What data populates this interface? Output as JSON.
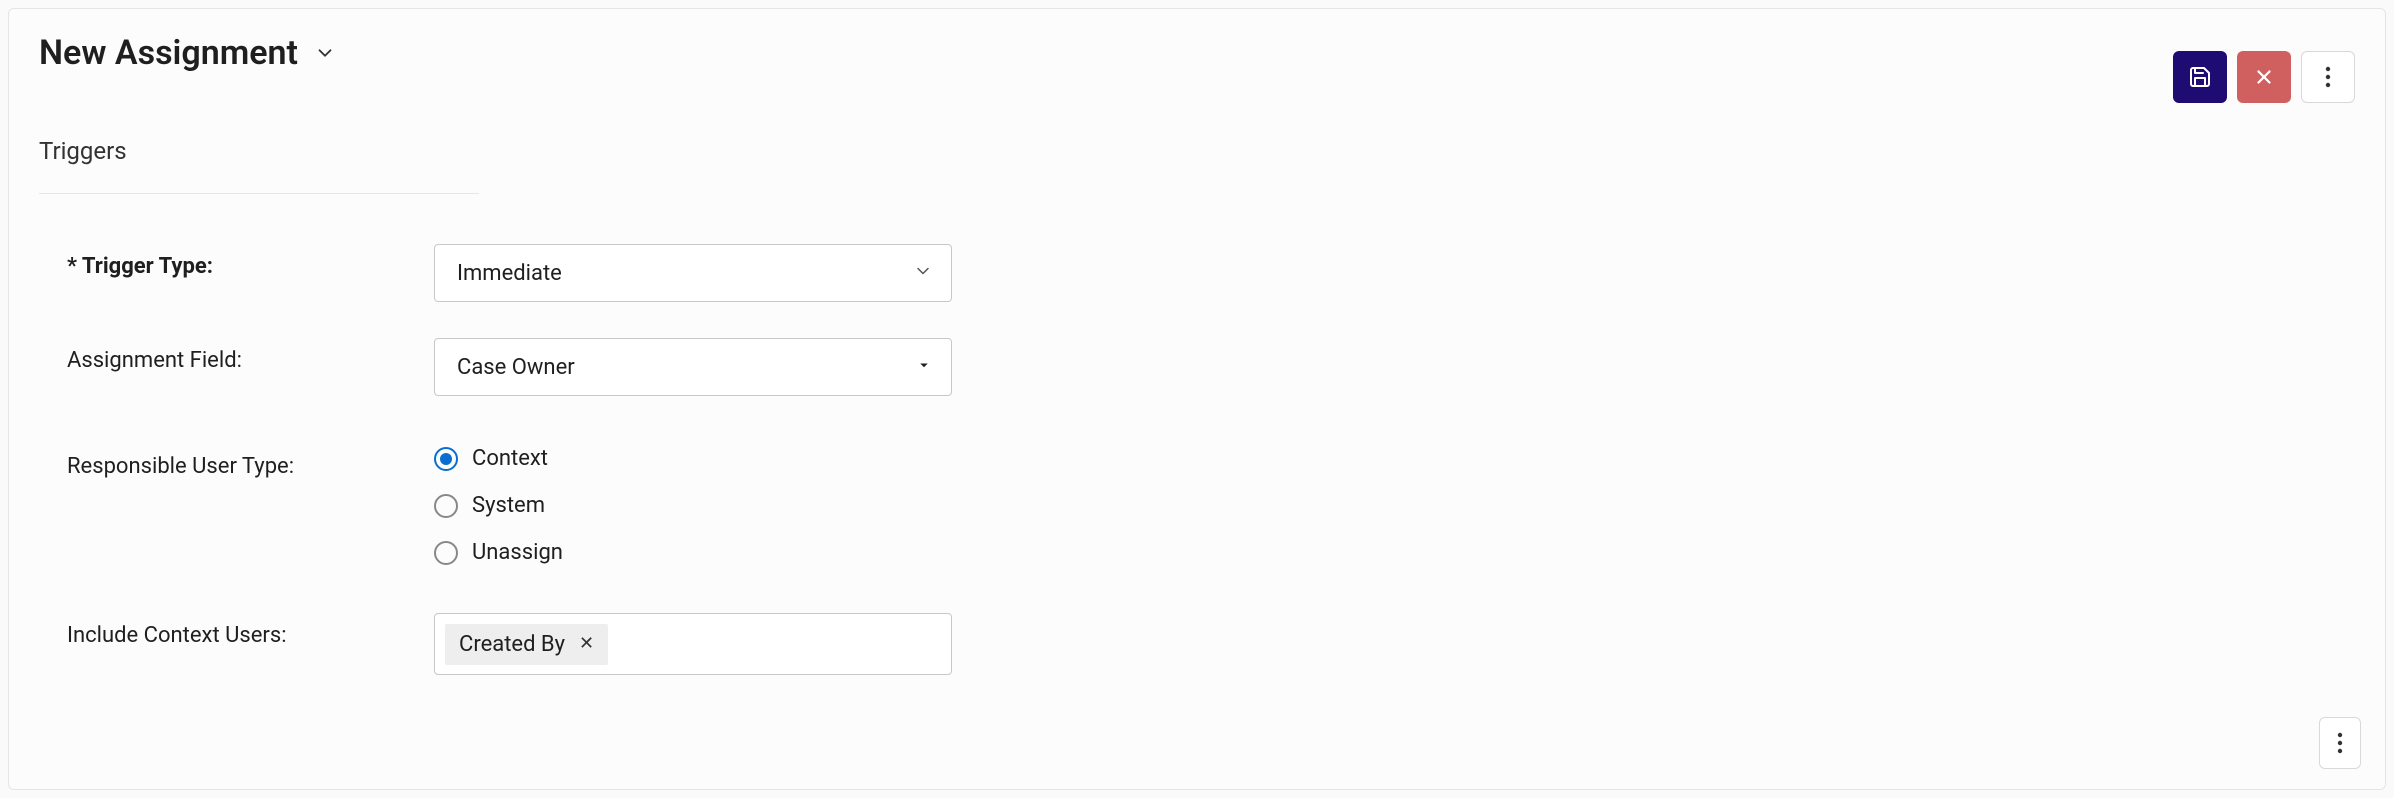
{
  "header": {
    "title": "New Assignment"
  },
  "section": {
    "title": "Triggers"
  },
  "form": {
    "trigger_type": {
      "label": "* Trigger Type:",
      "value": "Immediate"
    },
    "assignment_field": {
      "label": "Assignment Field:",
      "value": "Case Owner"
    },
    "responsible_user_type": {
      "label": "Responsible User Type:",
      "options": {
        "context": "Context",
        "system": "System",
        "unassign": "Unassign"
      },
      "selected": "context"
    },
    "include_context_users": {
      "label": "Include Context Users:",
      "tags": [
        {
          "label": "Created By"
        }
      ]
    }
  }
}
